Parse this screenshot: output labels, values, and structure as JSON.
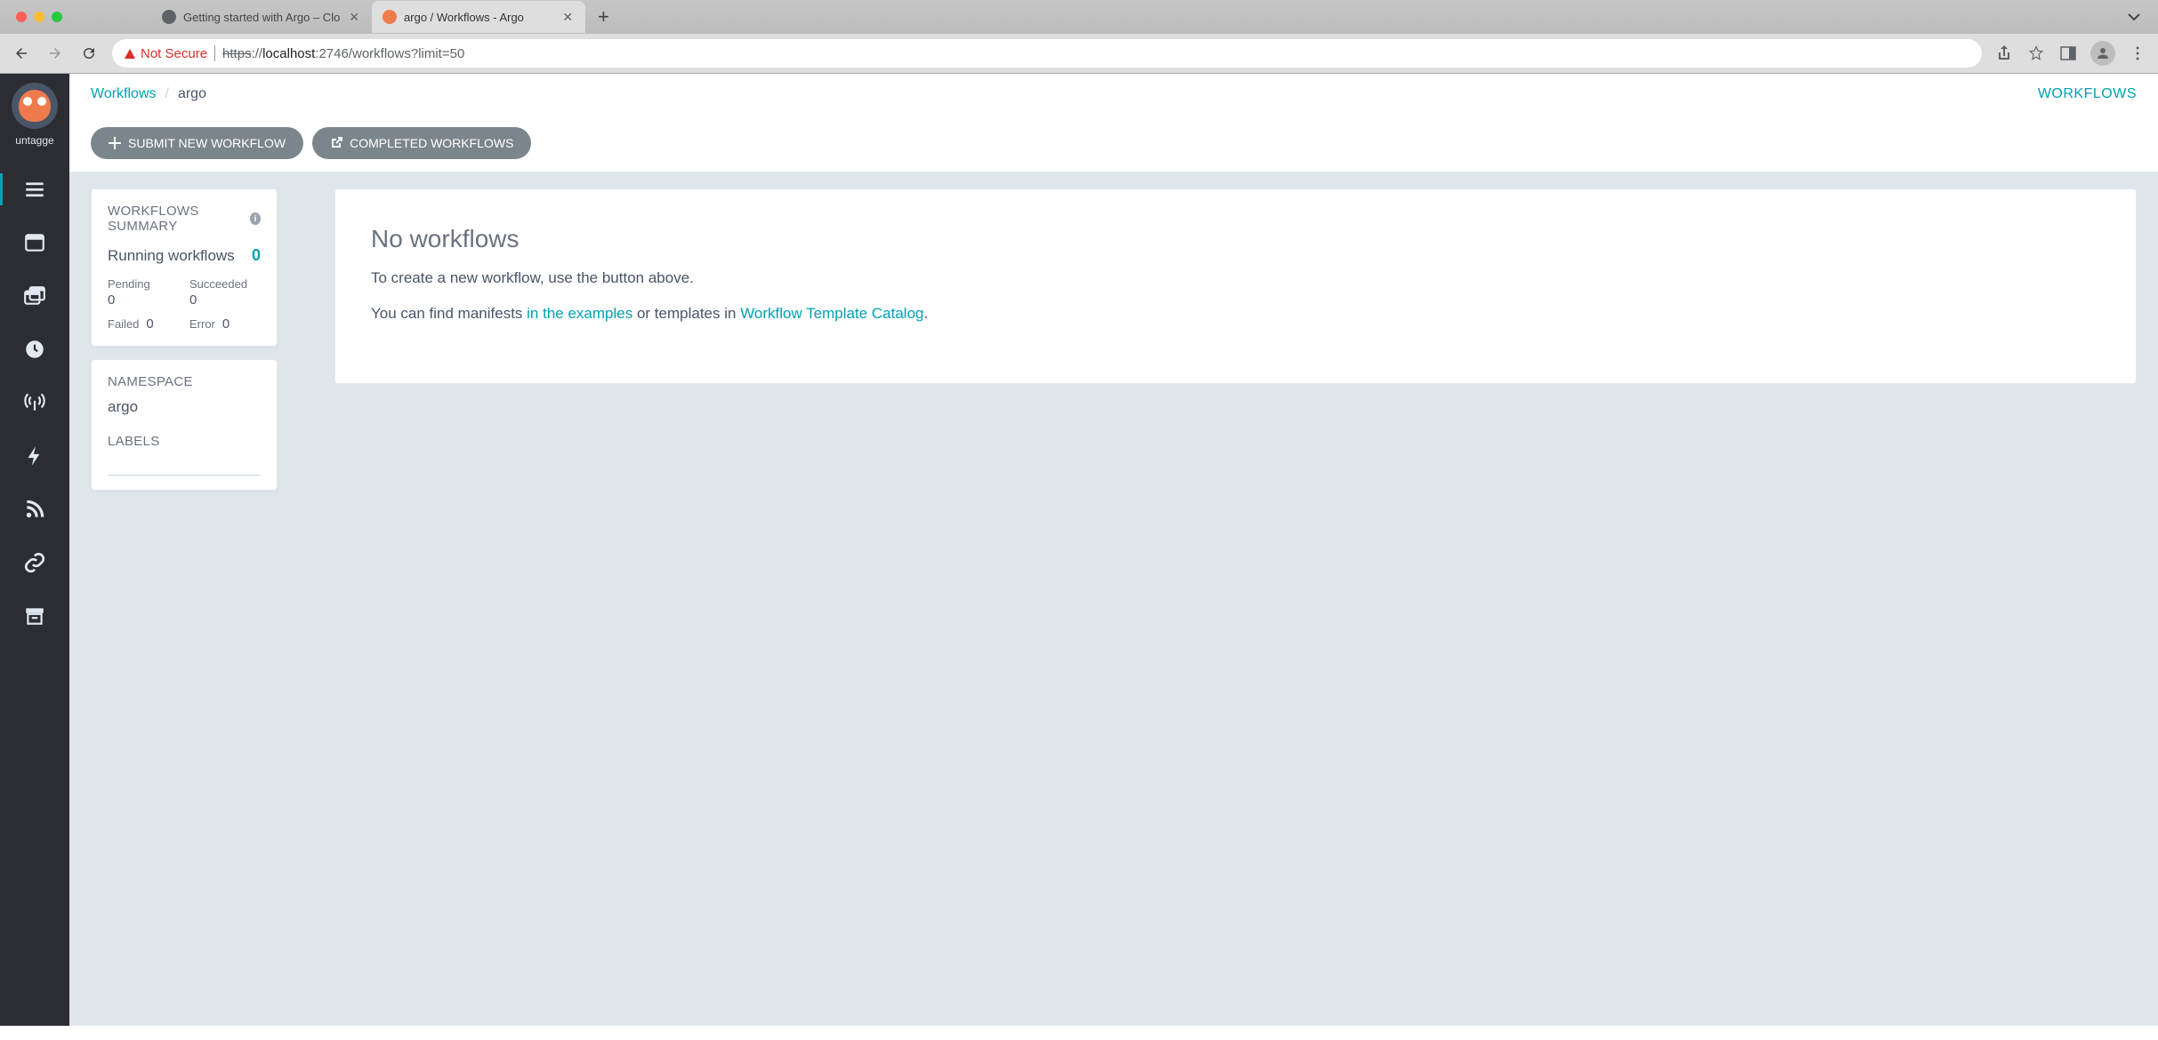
{
  "browser": {
    "tabs": [
      {
        "title": "Getting started with Argo – Clo",
        "active": false
      },
      {
        "title": "argo / Workflows - Argo",
        "active": true
      }
    ],
    "url": {
      "warning": "Not Secure",
      "scheme": "https",
      "host": "localhost",
      "port_path": ":2746/workflows?limit=50"
    }
  },
  "sidebar": {
    "user": "untagge"
  },
  "header": {
    "breadcrumb_root": "Workflows",
    "breadcrumb_current": "argo",
    "page_label": "WORKFLOWS",
    "submit_btn": "SUBMIT NEW WORKFLOW",
    "completed_btn": "COMPLETED WORKFLOWS"
  },
  "summary": {
    "title": "WORKFLOWS SUMMARY",
    "running_label": "Running workflows",
    "running_value": "0",
    "stats": {
      "pending_label": "Pending",
      "pending_value": "0",
      "succeeded_label": "Succeeded",
      "succeeded_value": "0",
      "failed_label": "Failed",
      "failed_value": "0",
      "error_label": "Error",
      "error_value": "0"
    }
  },
  "namespace": {
    "title": "NAMESPACE",
    "value": "argo",
    "labels_title": "LABELS"
  },
  "empty": {
    "title": "No workflows",
    "line1": "To create a new workflow, use the button above.",
    "line2_a": "You can find manifests ",
    "line2_link1": "in the examples",
    "line2_b": " or templates in ",
    "line2_link2": "Workflow Template Catalog",
    "line2_c": "."
  }
}
